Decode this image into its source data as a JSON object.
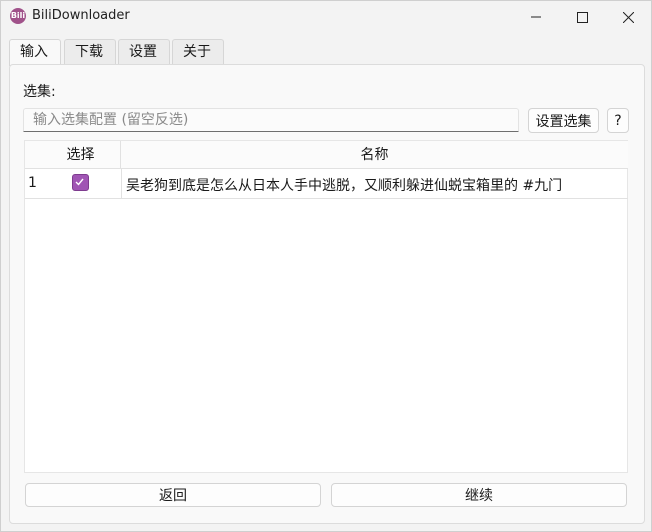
{
  "window": {
    "title": "BiliDownloader",
    "app_icon_text": "Bili"
  },
  "tabs": [
    {
      "label": "输入",
      "active": true
    },
    {
      "label": "下载",
      "active": false
    },
    {
      "label": "设置",
      "active": false
    },
    {
      "label": "关于",
      "active": false
    }
  ],
  "selection": {
    "label": "选集:",
    "input_value": "",
    "input_placeholder": "输入选集配置 (留空反选)",
    "set_button": "设置选集",
    "help_button": "?"
  },
  "table": {
    "columns": [
      "选择",
      "名称"
    ],
    "rows": [
      {
        "index": "1",
        "checked": true,
        "name": "吴老狗到底是怎么从日本人手中逃脱，又顺利躲进仙蜕宝箱里的 #九门"
      }
    ]
  },
  "footer": {
    "back_button": "返回",
    "continue_button": "继续"
  },
  "colors": {
    "accent": "#a055b4",
    "window_bg": "#f3f3f3"
  }
}
